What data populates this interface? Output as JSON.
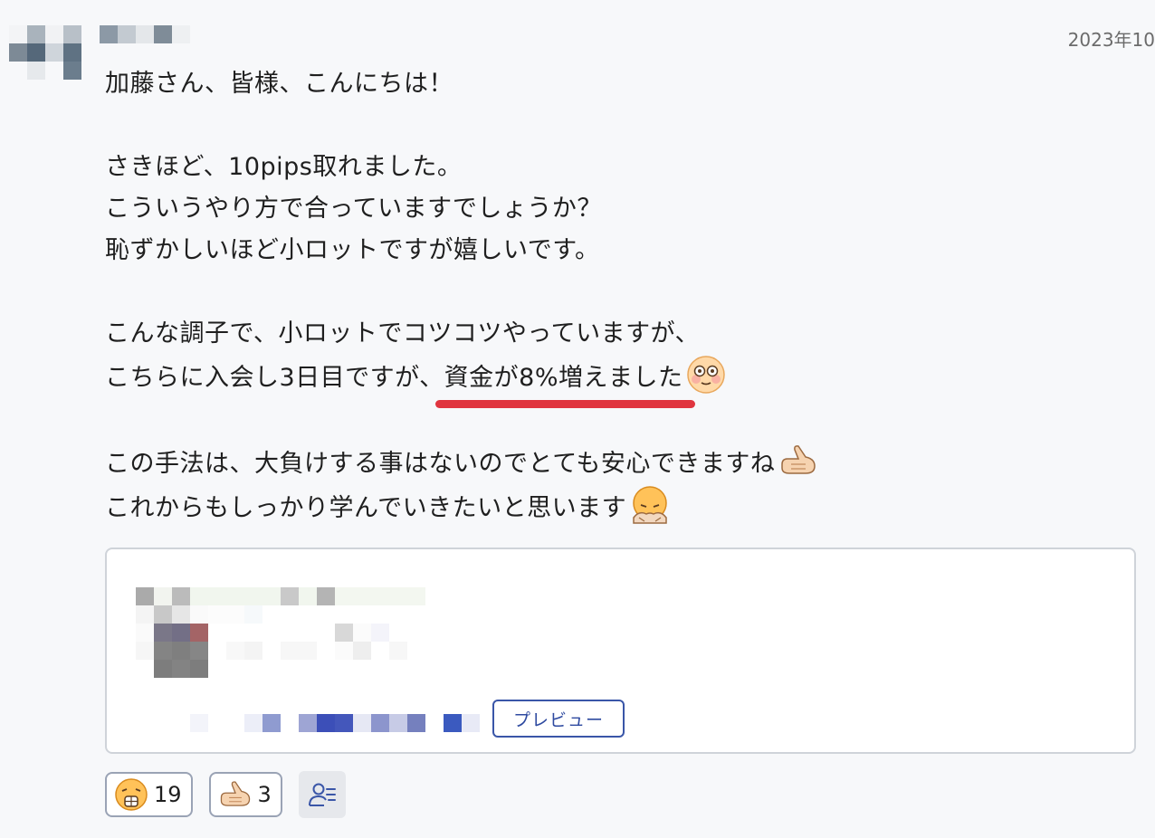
{
  "post": {
    "timestamp": "2023年10",
    "lines": [
      "加藤さん、皆様、こんにちは！",
      "",
      "さきほど、10pips取れました。",
      "こういうやり方で合っていますでしょうか？",
      "恥ずかしいほど小ロットですが嬉しいです。",
      "",
      "こんな調子で、小ロットでコツコツやっていますが、"
    ],
    "line7_prefix": "こちらに入会し3日目ですが、",
    "line7_highlight": "資金が8%増えました",
    "line9": "この手法は、大負けする事はないのでとても安心できますね",
    "line10": "これからもしっかり学んでいきたいと思います",
    "emoji_icons": [
      "flushed-face-icon",
      "thumbs-up-icon",
      "bowing-face-icon"
    ],
    "highlight_color": "#e0353f"
  },
  "link_card": {
    "preview_label": "プレビュー"
  },
  "reactions": [
    {
      "icon": "laughing-face-icon",
      "count": "19"
    },
    {
      "icon": "thumbs-up-icon",
      "count": "3"
    }
  ],
  "members_icon": "members-list-icon"
}
